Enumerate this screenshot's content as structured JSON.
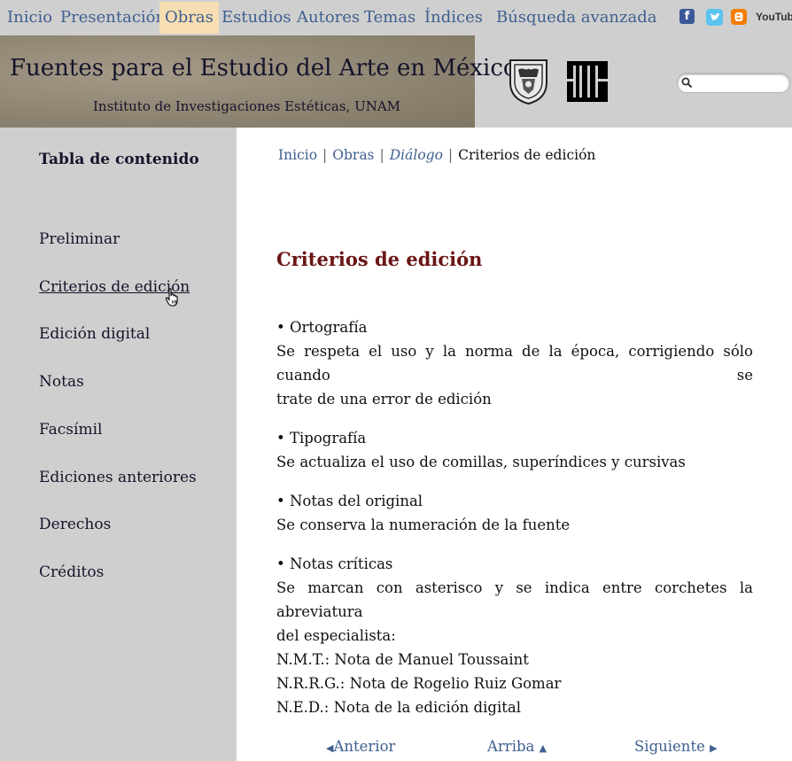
{
  "nav": {
    "items": [
      "Inicio",
      "Presentación",
      "Obras",
      "Estudios",
      "Autores",
      "Temas",
      "Índices"
    ],
    "advanced": "Búsqueda avanzada",
    "active_color": "#f6ddb2",
    "link_color": "#3f5f8f"
  },
  "social": {
    "facebook": "f",
    "youtube": "YouTube",
    "icons": [
      "facebook-icon",
      "twitter-icon",
      "blogger-icon",
      "youtube-icon"
    ]
  },
  "header": {
    "title": "Fuentes para el Estudio del Arte en México",
    "subtitle": "Instituto de Investigaciones Estéticas, UNAM"
  },
  "sidebar": {
    "title": "Tabla de contenido",
    "items": [
      "Preliminar",
      "Criterios de edición",
      "Edición digital",
      "Notas",
      "Facsímil",
      "Ediciones anteriores",
      "Derechos",
      "Créditos"
    ]
  },
  "breadcrumb": {
    "items": [
      "Inicio",
      "Obras",
      "Diálogo"
    ],
    "current": "Criterios de edición"
  },
  "main": {
    "title": "Criterios de edición",
    "title_color": "#6b1515",
    "sections": [
      {
        "heading": "• Ortografía",
        "body": "Se respeta el uso y la norma de la época, corrigiendo sólo cuando se",
        "body2": "trate de una error de edición"
      },
      {
        "heading": "• Tipografía",
        "body": "Se actualiza el uso de comillas, superíndices y cursivas"
      },
      {
        "heading": "• Notas del original",
        "body": "Se conserva la numeración de la fuente"
      },
      {
        "heading": "• Notas críticas",
        "body": "Se marcan con asterisco y se indica entre corchetes la abreviatura",
        "body2": "del especialista:",
        "notes": [
          "N.M.T.: Nota de Manuel Toussaint",
          "N.R.R.G.: Nota de Rogelio Ruiz Gomar",
          "N.E.D.: Nota de la edición digital"
        ]
      }
    ]
  },
  "pager": {
    "prev": "Anterior",
    "up": "Arriba",
    "next": "Siguiente"
  }
}
